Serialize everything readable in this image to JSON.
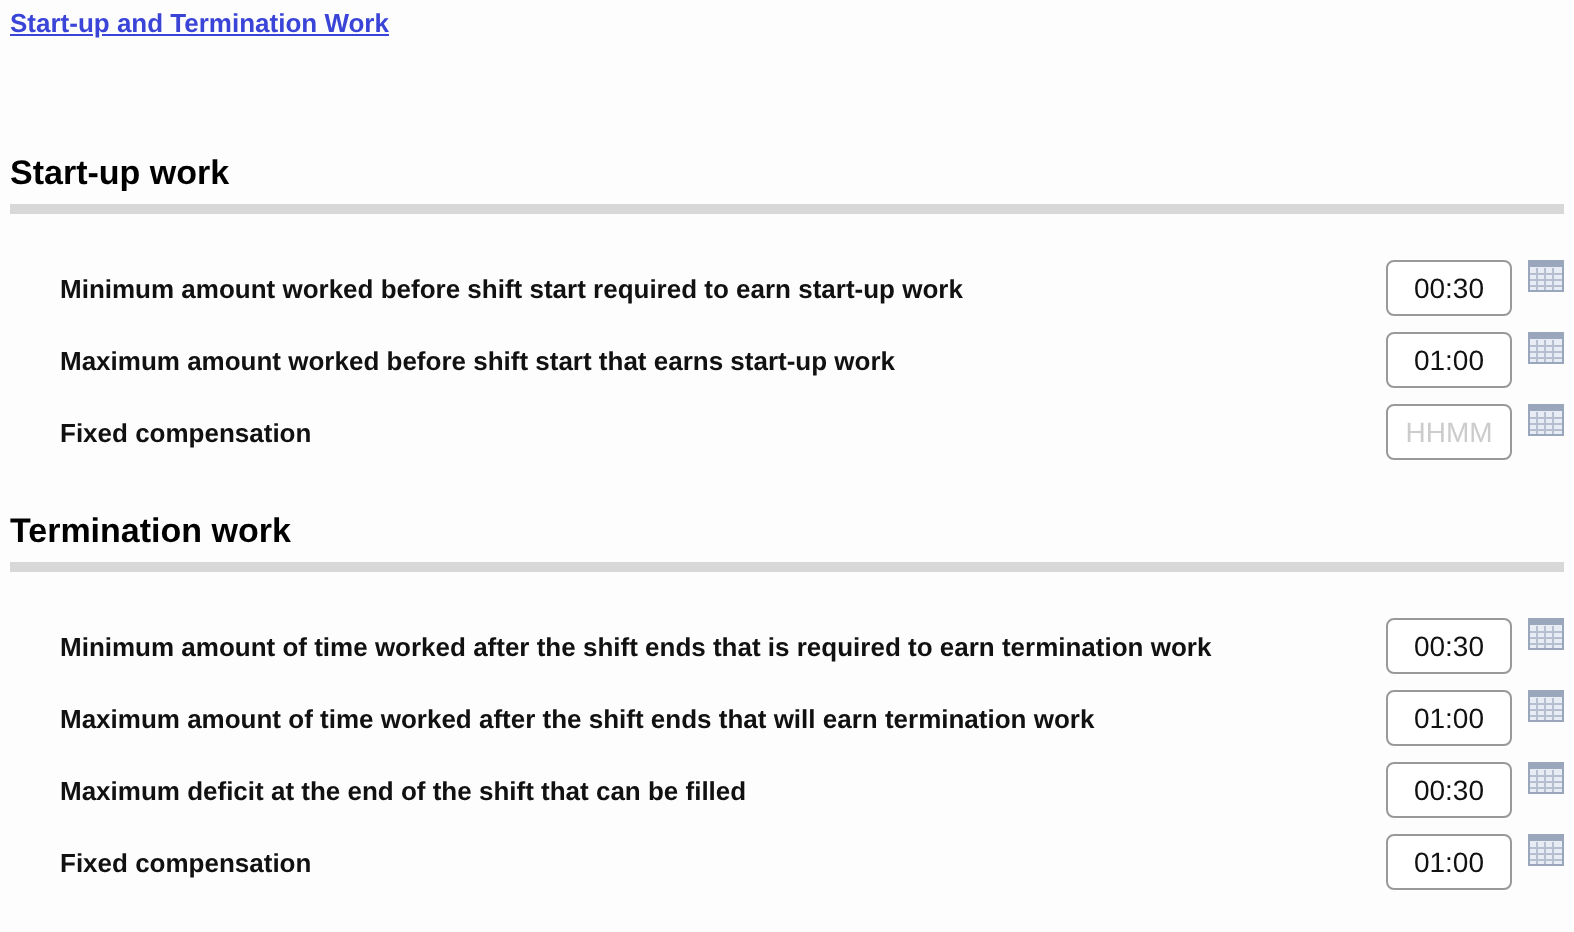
{
  "link": "Start-up and Termination Work",
  "sections": [
    {
      "title": "Start-up work",
      "rows": [
        {
          "label": "Minimum amount worked before shift start required to earn start-up work",
          "value": "00:30"
        },
        {
          "label": "Maximum amount worked before shift start that earns start-up work",
          "value": "01:00"
        },
        {
          "label": "Fixed compensation",
          "placeholder": "HHMM"
        }
      ]
    },
    {
      "title": "Termination work",
      "rows": [
        {
          "label": "Minimum amount of time worked after the shift ends that is required to earn termination work",
          "value": "00:30"
        },
        {
          "label": "Maximum amount of time worked after the shift ends that will earn termination work",
          "value": "01:00"
        },
        {
          "label": "Maximum deficit at the end of the shift that can be filled",
          "value": "00:30"
        },
        {
          "label": "Fixed compensation",
          "value": "01:00"
        }
      ]
    }
  ]
}
